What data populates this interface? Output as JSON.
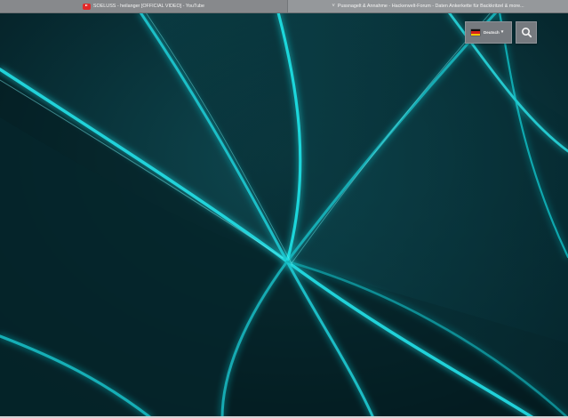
{
  "browser": {
    "tabs": [
      {
        "label": "SOELUSS - heilanger [OFFICIAL VIDEO] - YouTube",
        "icon": "youtube-icon"
      },
      {
        "label": "Pussnagelt & Annahme - Hackerwelt-Forum - Daten Ankerkette für Backkritzel & more...",
        "icon": "dropdown-icon"
      }
    ]
  },
  "overlay": {
    "language_label": "Deutsch",
    "language_arrow": "▾",
    "flag_icon": "germany-flag-icon",
    "search_icon": "search-icon"
  },
  "colors": {
    "background": "#0b3138",
    "accent": "#18d7dc",
    "tabbar": "#8b8e91",
    "button": "#767a7f",
    "youtube": "#e32828"
  }
}
